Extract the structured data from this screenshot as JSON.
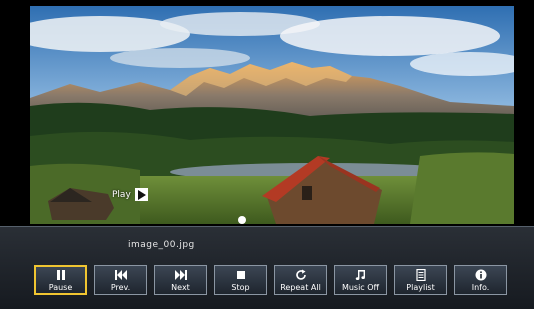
{
  "photo": {
    "overlay_label": "Play"
  },
  "panel": {
    "filename": "image_00.jpg"
  },
  "controls": [
    {
      "label": "Pause",
      "icon": "pause-icon",
      "active": true
    },
    {
      "label": "Prev.",
      "icon": "previous-icon"
    },
    {
      "label": "Next",
      "icon": "next-icon"
    },
    {
      "label": "Stop",
      "icon": "stop-icon"
    },
    {
      "label": "Repeat All",
      "icon": "repeat-icon"
    },
    {
      "label": "Music Off",
      "icon": "music-icon"
    },
    {
      "label": "Playlist",
      "icon": "playlist-icon"
    },
    {
      "label": "Info.",
      "icon": "info-icon"
    }
  ],
  "colors": {
    "focus_border": "#f0c531",
    "panel_bg": "#1e252e"
  }
}
